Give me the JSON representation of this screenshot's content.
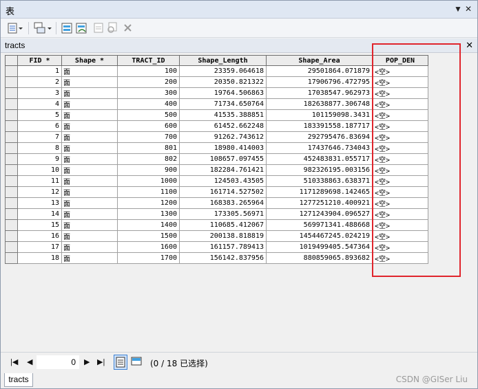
{
  "window": {
    "title": "表"
  },
  "toolbar": {
    "icons": [
      "table-options-icon",
      "related-tables-icon",
      "select-by-attributes-icon",
      "switch-selection-icon",
      "clear-selection-icon",
      "zoom-to-selected-icon",
      "delete-selected-icon"
    ]
  },
  "table": {
    "name": "tracts",
    "columns": [
      "FID *",
      "Shape *",
      "TRACT_ID",
      "Shape_Length",
      "Shape_Area",
      "POP_DEN"
    ],
    "rows": [
      [
        "1",
        "面",
        "100",
        "23359.064618",
        "29501864.071879",
        "<空>"
      ],
      [
        "2",
        "面",
        "200",
        "20350.821322",
        "17906796.472795",
        "<空>"
      ],
      [
        "3",
        "面",
        "300",
        "19764.506863",
        "17038547.962973",
        "<空>"
      ],
      [
        "4",
        "面",
        "400",
        "71734.650764",
        "182638877.306748",
        "<空>"
      ],
      [
        "5",
        "面",
        "500",
        "41535.388851",
        "101159098.3431",
        "<空>"
      ],
      [
        "6",
        "面",
        "600",
        "61452.662248",
        "183391558.187717",
        "<空>"
      ],
      [
        "7",
        "面",
        "700",
        "91262.743612",
        "292795476.83694",
        "<空>"
      ],
      [
        "8",
        "面",
        "801",
        "18980.414003",
        "17437646.734043",
        "<空>"
      ],
      [
        "9",
        "面",
        "802",
        "108657.097455",
        "452483831.055717",
        "<空>"
      ],
      [
        "10",
        "面",
        "900",
        "182284.761421",
        "982326195.003156",
        "<空>"
      ],
      [
        "11",
        "面",
        "1000",
        "124503.43505",
        "510338863.638371",
        "<空>"
      ],
      [
        "12",
        "面",
        "1100",
        "161714.527502",
        "1171289698.142465",
        "<空>"
      ],
      [
        "13",
        "面",
        "1200",
        "168383.265964",
        "1277251210.400921",
        "<空>"
      ],
      [
        "14",
        "面",
        "1300",
        "173305.56971",
        "1271243904.096527",
        "<空>"
      ],
      [
        "15",
        "面",
        "1400",
        "110685.412067",
        "569971341.488668",
        "<空>"
      ],
      [
        "16",
        "面",
        "1500",
        "200138.818819",
        "1454467245.024219",
        "<空>"
      ],
      [
        "17",
        "面",
        "1600",
        "161157.789413",
        "1019499405.547364",
        "<空>"
      ],
      [
        "18",
        "面",
        "1700",
        "156142.837956",
        "880859065.893682",
        "<空>"
      ]
    ]
  },
  "nav": {
    "record": "0",
    "status": "(0 / 18 已选择)"
  },
  "bottom_tab": "tracts",
  "watermark": "CSDN @GISer Liu",
  "colors": {
    "highlight_box": "#e0242c"
  }
}
